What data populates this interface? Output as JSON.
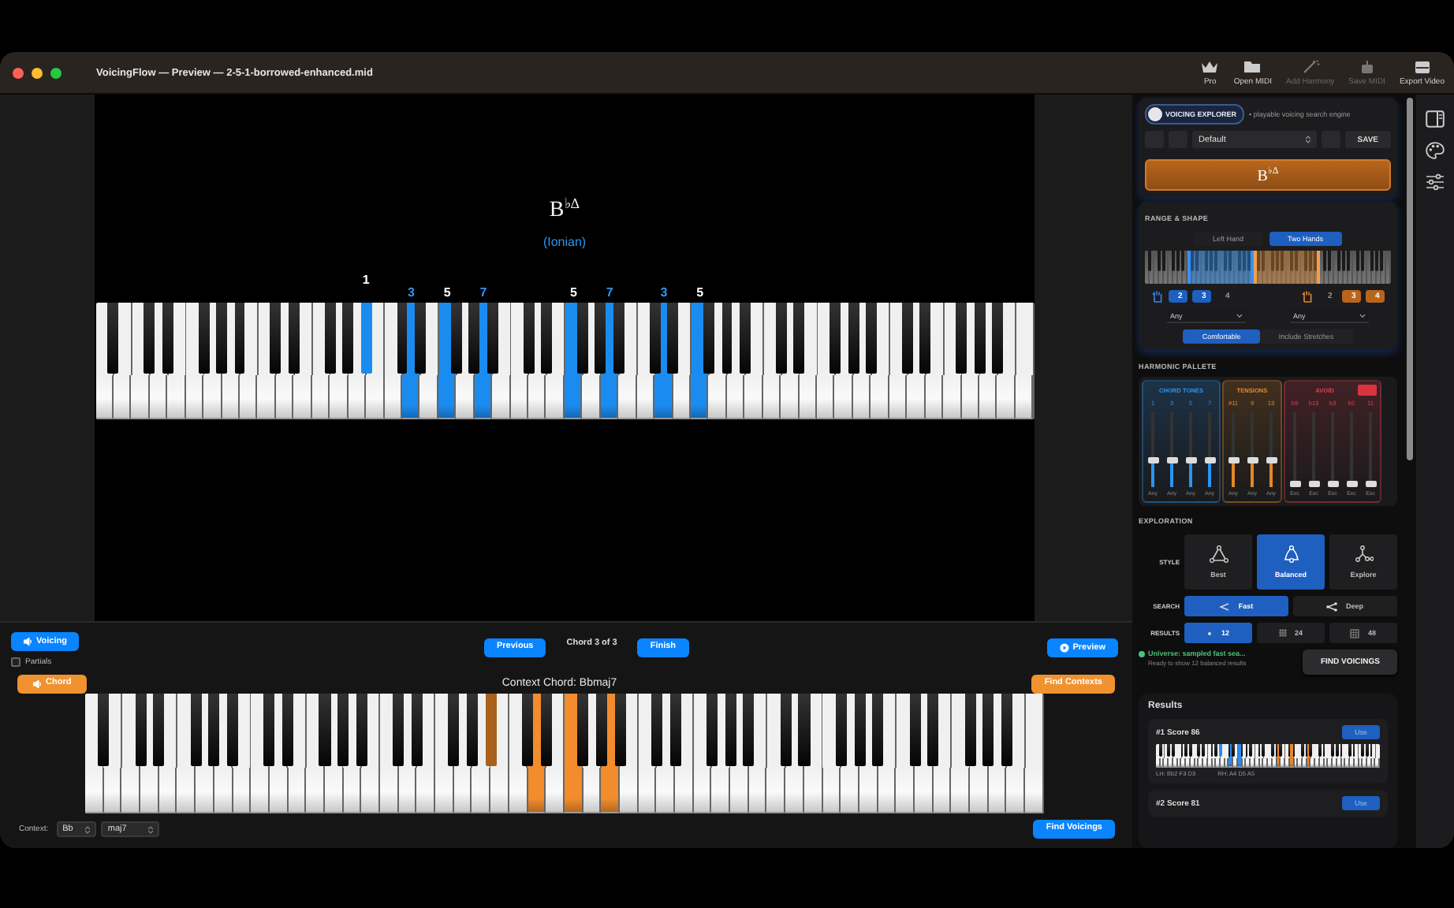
{
  "window": {
    "title": "VoicingFlow — Preview — 2-5-1-borrowed-enhanced.mid"
  },
  "toolbar": [
    {
      "label": "Pro",
      "kind": "pro",
      "disabled": false
    },
    {
      "label": "Open MIDI",
      "kind": "open",
      "disabled": false
    },
    {
      "label": "Add Harmony",
      "kind": "harmony",
      "disabled": true
    },
    {
      "label": "Save MIDI",
      "kind": "save",
      "disabled": true
    },
    {
      "label": "Export Video",
      "kind": "export",
      "disabled": false
    }
  ],
  "preview": {
    "chord_symbol": "B$^{♭Δ}$",
    "mode": "(Ionian)",
    "keyboard": {
      "highlighted": [
        false,
        false,
        false,
        false,
        false,
        false,
        false,
        false,
        false,
        false,
        false,
        false,
        false,
        false,
        false,
        false,
        false,
        false,
        false,
        false,
        false,
        false,
        false,
        false,
        false,
        true,
        false,
        false,
        false,
        true,
        false,
        false,
        true,
        false,
        false,
        false,
        true,
        false,
        false,
        false,
        false,
        false,
        false,
        false,
        true,
        false,
        false,
        false,
        true,
        false,
        false,
        false,
        false,
        true,
        false,
        false,
        true,
        false,
        false,
        false,
        false,
        false,
        false,
        false,
        false,
        false,
        false,
        false,
        false,
        false,
        false,
        false,
        false,
        false,
        false,
        false,
        false,
        false,
        false,
        false,
        false,
        false,
        false,
        false,
        false,
        false,
        false,
        false
      ],
      "labels": [
        {
          "label": "1",
          "color": "#ffffff"
        },
        {
          "label": "3",
          "color": "#2b95f0"
        },
        {
          "label": "5",
          "color": "#ffffff"
        },
        {
          "label": "7",
          "color": "#2b95f0"
        },
        {
          "label": "5",
          "color": "#ffffff"
        },
        {
          "label": "7",
          "color": "#2b95f0"
        },
        {
          "label": "3",
          "color": "#2b95f0"
        },
        {
          "label": "5",
          "color": "#ffffff"
        }
      ]
    }
  },
  "voicing_button": "Voicing",
  "partials": {
    "label": "Partials",
    "checked": false
  },
  "navigation": {
    "previous": "Previous",
    "position": "Chord 3 of 3",
    "finish": "Finish"
  },
  "preview_button": "Preview",
  "context": {
    "chord_button": "Chord",
    "title": "Context Chord: Bbmaj7",
    "find_contexts": "Find Contexts",
    "keyboard": {
      "highlighted": [
        false,
        false,
        false,
        false,
        false,
        false,
        false,
        false,
        false,
        false,
        false,
        false,
        false,
        false,
        false,
        false,
        false,
        false,
        false,
        false,
        false,
        false,
        false,
        false,
        false,
        false,
        false,
        false,
        false,
        false,
        false,
        false,
        false,
        false,
        false,
        false,
        false,
        true,
        false,
        false,
        false,
        true,
        false,
        false,
        true,
        false,
        false,
        false,
        true,
        false,
        false,
        false,
        false,
        false,
        false,
        false,
        false,
        false,
        false,
        false,
        false,
        false,
        false,
        false,
        false,
        false,
        false,
        false,
        false,
        false,
        false,
        false,
        false,
        false,
        false,
        false,
        false,
        false,
        false,
        false,
        false,
        false,
        false,
        false,
        false,
        false,
        false,
        false
      ],
      "highlights": [
        {
          "color": "#a9611c"
        },
        {
          "color": "#f28c2c"
        },
        {
          "color": "#f28c2c"
        },
        {
          "color": "#f28c2c"
        }
      ]
    },
    "label": "Context:",
    "root": "Bb",
    "quality": "maj7",
    "find_voicings": "Find Voicings"
  },
  "explorer": {
    "logo": "VOICING EXPLORER",
    "tagline": "• playable voicing search engine",
    "preset": "Default",
    "save": "SAVE",
    "chord_button": "B$^{♭Δ}$"
  },
  "range_shape": {
    "title": "RANGE & SHAPE",
    "tabs": [
      {
        "label": "Left Hand",
        "selected": false
      },
      {
        "label": "Two Hands",
        "selected": true
      }
    ],
    "left_hand": {
      "fingers": [
        {
          "label": "2",
          "selected": true
        },
        {
          "label": "3",
          "selected": true
        },
        {
          "label": "4",
          "selected": false
        }
      ],
      "span": "Any"
    },
    "right_hand": {
      "fingers": [
        {
          "label": "2",
          "selected": false
        },
        {
          "label": "3",
          "selected": true
        },
        {
          "label": "4",
          "selected": true
        }
      ],
      "span": "Any"
    },
    "stretch": [
      {
        "label": "Comfortable",
        "selected": true
      },
      {
        "label": "Include Stretches",
        "selected": false
      }
    ]
  },
  "harmonic_palette": {
    "title": "HARMONIC PALLETE",
    "groups": [
      {
        "name": "CHORD TONES",
        "color": "#2b95f0",
        "sliders": [
          {
            "label": "1",
            "level": 0.35,
            "value": "Any"
          },
          {
            "label": "3",
            "level": 0.35,
            "value": "Any"
          },
          {
            "label": "5",
            "level": 0.35,
            "value": "Any"
          },
          {
            "label": "7",
            "level": 0.35,
            "value": "Any"
          }
        ]
      },
      {
        "name": "TENSIONS",
        "color": "#e0892b",
        "sliders": [
          {
            "label": "#11",
            "level": 0.35,
            "value": "Any"
          },
          {
            "label": "9",
            "level": 0.35,
            "value": "Any"
          },
          {
            "label": "13",
            "level": 0.35,
            "value": "Any"
          }
        ]
      },
      {
        "name": "AVOID",
        "color": "#e0404f",
        "sliders": [
          {
            "label": "b9",
            "level": 0.05,
            "value": "Exc"
          },
          {
            "label": "b13",
            "level": 0.05,
            "value": "Exc"
          },
          {
            "label": "b3",
            "level": 0.05,
            "value": "Exc"
          },
          {
            "label": "b5",
            "level": 0.05,
            "value": "Exc"
          },
          {
            "label": "11",
            "level": 0.05,
            "value": "Exc"
          }
        ]
      }
    ]
  },
  "exploration": {
    "title": "EXPLORATION",
    "style": {
      "label": "STYLE",
      "options": [
        {
          "label": "Best",
          "kind": "best",
          "selected": false
        },
        {
          "label": "Balanced",
          "kind": "balanced",
          "selected": true
        },
        {
          "label": "Explore",
          "kind": "explore",
          "selected": false
        }
      ]
    },
    "search": {
      "label": "SEARCH",
      "options": [
        {
          "label": "Fast",
          "kind": "fast",
          "selected": true
        },
        {
          "label": "Deep",
          "kind": "deep",
          "selected": false
        }
      ]
    },
    "results": {
      "label": "RESULTS",
      "options": [
        {
          "label": "12",
          "kind": "few",
          "selected": true
        },
        {
          "label": "24",
          "kind": "some",
          "selected": false
        },
        {
          "label": "48",
          "kind": "many",
          "selected": false
        }
      ]
    },
    "status": "Universe: sampled fast sea...",
    "status_detail": "Ready to show 12 balanced results",
    "find": "FIND VOICINGS"
  },
  "results": {
    "title": "Results",
    "items": [
      {
        "title": "#1 Score 86",
        "button": "Use",
        "left_label": "LH: Bb2 F3 D3",
        "right_label": "RH: A4 D5 A5",
        "highlighted": [
          false,
          false,
          false,
          false,
          false,
          false,
          false,
          false,
          false,
          false,
          false,
          false,
          false,
          false,
          false,
          false,
          false,
          false,
          false,
          false,
          false,
          false,
          false,
          false,
          false,
          true,
          false,
          false,
          false,
          true,
          false,
          false,
          true,
          false,
          false,
          false,
          false,
          false,
          false,
          false,
          false,
          false,
          false,
          false,
          false,
          false,
          false,
          false,
          true,
          false,
          false,
          false,
          false,
          true,
          false,
          false,
          false,
          false,
          false,
          false,
          true,
          false,
          false,
          false,
          false,
          false,
          false,
          false,
          false,
          false,
          false,
          false,
          false,
          false,
          false,
          false,
          false,
          false,
          false,
          false,
          false,
          false,
          false,
          false,
          false,
          false,
          false,
          false
        ],
        "highlights": [
          {
            "color": "#2b8cf0"
          },
          {
            "color": "#2b8cf0"
          },
          {
            "color": "#2b8cf0"
          },
          {
            "color": "#e8862a"
          },
          {
            "color": "#e8862a"
          },
          {
            "color": "#e8862a"
          }
        ]
      },
      {
        "title": "#2 Score 81",
        "button": "Use"
      }
    ]
  }
}
